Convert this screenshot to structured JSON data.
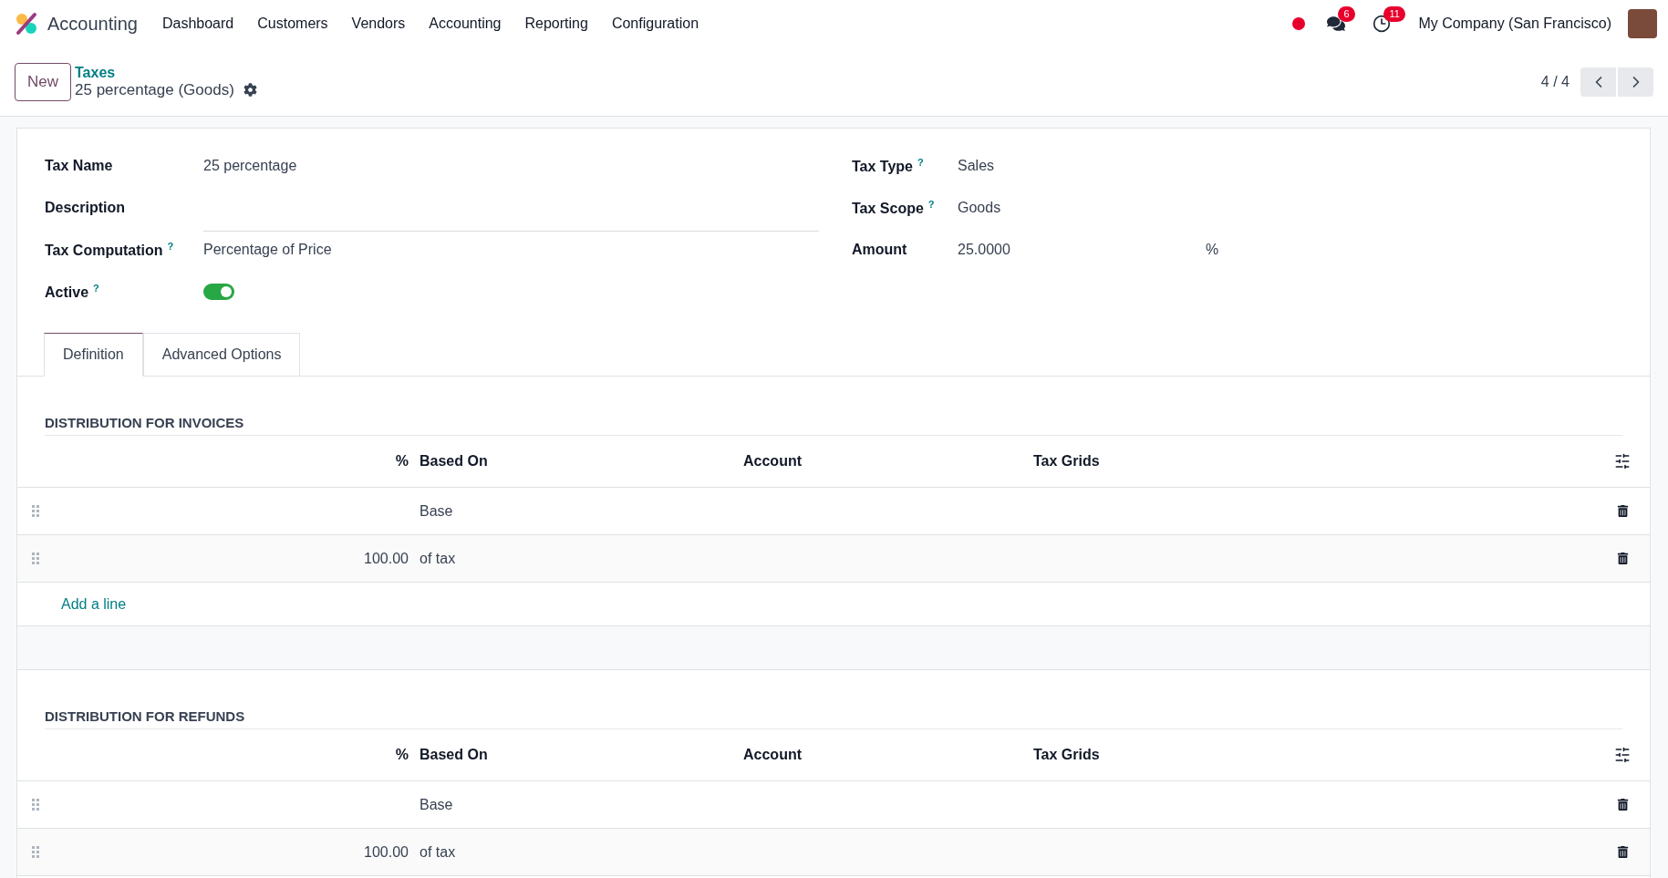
{
  "navbar": {
    "app_name": "Accounting",
    "menu": [
      "Dashboard",
      "Customers",
      "Vendors",
      "Accounting",
      "Reporting",
      "Configuration"
    ],
    "notifications": [
      {
        "kind": "messages",
        "count": "6"
      },
      {
        "kind": "activities",
        "count": "11"
      }
    ],
    "company": "My Company (San Francisco)"
  },
  "control_panel": {
    "new_button": "New",
    "breadcrumb": "Taxes",
    "record_title": "25 percentage (Goods)",
    "pager": "4 / 4"
  },
  "form": {
    "left_fields": [
      {
        "kind": "text",
        "label": "Tax Name",
        "value": "25 percentage"
      },
      {
        "kind": "input",
        "label": "Description"
      },
      {
        "kind": "text",
        "label": "Tax Computation",
        "help_mark": "?",
        "value": "Percentage of Price"
      },
      {
        "kind": "toggle",
        "label": "Active",
        "help_mark": "?",
        "on": true
      }
    ],
    "right_fields": [
      {
        "label": "Tax Type",
        "help_mark": "?",
        "value": "Sales"
      },
      {
        "label": "Tax Scope",
        "help_mark": "?",
        "value": "Goods"
      },
      {
        "label": "Amount",
        "value": "25.0000",
        "suffix": "%"
      }
    ],
    "tabs": [
      {
        "label": "Definition",
        "selected": true
      },
      {
        "label": "Advanced Options",
        "selected": false
      }
    ],
    "sections": [
      {
        "title": "DISTRIBUTION FOR INVOICES",
        "columns": [
          "%",
          "Based On",
          "Account",
          "Tax Grids"
        ],
        "rows": [
          {
            "based_on": "Base"
          },
          {
            "percent": "100.00",
            "based_on": "of tax"
          }
        ],
        "add_line": "Add a line"
      },
      {
        "title": "DISTRIBUTION FOR REFUNDS",
        "columns": [
          "%",
          "Based On",
          "Account",
          "Tax Grids"
        ],
        "rows": [
          {
            "based_on": "Base"
          },
          {
            "percent": "100.00",
            "based_on": "of tax"
          }
        ]
      }
    ]
  }
}
